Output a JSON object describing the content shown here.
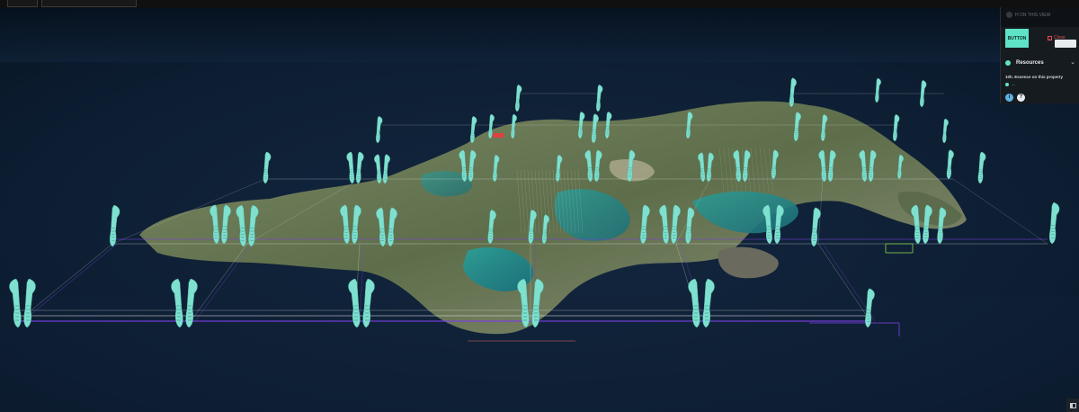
{
  "app": {
    "toolbar": {
      "tabs": [
        "",
        ""
      ]
    }
  },
  "panel": {
    "header_text": "H  ON THIS VIEW",
    "accent_button_label": "BUTTON",
    "close_link_label": "Close",
    "resources_label": "Resources",
    "resources_description": "10h. Essence on this property",
    "resources_sub_value": "—",
    "info_icon_glyph": "i",
    "help_icon_glyph": "?",
    "chevron_icon": "chevron-down-icon"
  },
  "colors": {
    "accent": "#5fe3c7",
    "sea": "#0a1a2e",
    "land": "#6a7a52",
    "grid_white": "#e6e6e6",
    "grid_purple": "#7b3fe3",
    "grid_green": "#7fc24a",
    "wind_turbine": "#7fe0cf"
  },
  "scene": {
    "description_icons": [
      "wind-turbine-icon",
      "grid-line-icon",
      "island-icon"
    ]
  }
}
